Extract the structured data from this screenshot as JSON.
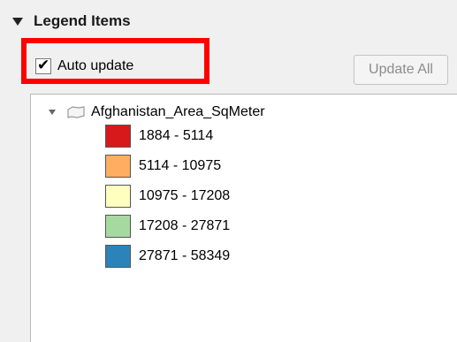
{
  "section": {
    "title": "Legend Items"
  },
  "auto_update": {
    "label": "Auto update",
    "checked": true,
    "checkmark": "✔"
  },
  "update_all": {
    "label": "Update All",
    "enabled": false
  },
  "layer": {
    "name": "Afghanistan_Area_SqMeter",
    "icon": "polygon-layer-icon",
    "items": [
      {
        "label": "1884 - 5114",
        "color": "#d7191c"
      },
      {
        "label": "5114 - 10975",
        "color": "#fdae61"
      },
      {
        "label": "10975 - 17208",
        "color": "#ffffc0"
      },
      {
        "label": "17208 - 27871",
        "color": "#a6d9a0"
      },
      {
        "label": "27871 - 58349",
        "color": "#2b83ba"
      }
    ]
  },
  "highlight_color": "#ff0000"
}
